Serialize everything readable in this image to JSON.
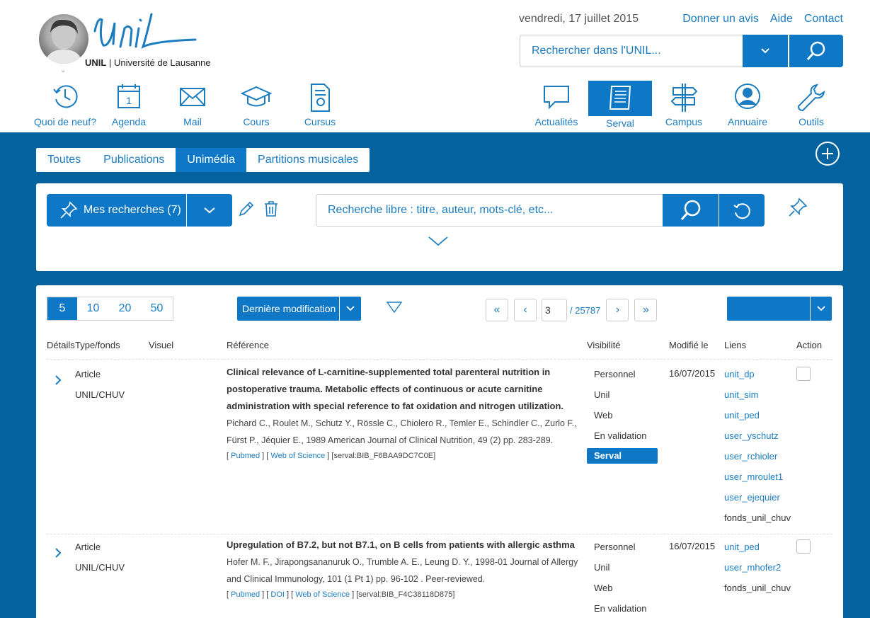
{
  "header": {
    "logo_wordmark": "Unil",
    "logo_short": "UNIL",
    "logo_long": "Université de Lausanne",
    "date": "vendredi, 17 juillet 2015",
    "top_links": [
      "Donner un avis",
      "Aide",
      "Contact"
    ],
    "search_placeholder": "Rechercher dans l'UNIL...",
    "left_nav": [
      {
        "label": "Quoi de neuf?",
        "icon": "clock-icon"
      },
      {
        "label": "Agenda",
        "icon": "calendar-icon",
        "day": "1"
      },
      {
        "label": "Mail",
        "icon": "envelope-icon"
      },
      {
        "label": "Cours",
        "icon": "graduation-cap-icon"
      },
      {
        "label": "Cursus",
        "icon": "certificate-icon"
      }
    ],
    "right_nav": [
      {
        "label": "Actualités",
        "icon": "speech-bubble-icon"
      },
      {
        "label": "Serval",
        "icon": "scroll-icon",
        "active": true
      },
      {
        "label": "Campus",
        "icon": "signpost-icon"
      },
      {
        "label": "Annuaire",
        "icon": "person-icon"
      },
      {
        "label": "Outils",
        "icon": "wrench-icon"
      }
    ]
  },
  "tabs": [
    "Toutes",
    "Publications",
    "Unimédia",
    "Partitions musicales"
  ],
  "active_tab": "Unimédia",
  "search_panel": {
    "saved_searches_label": "Mes recherches (7)",
    "free_search_placeholder": "Recherche libre : titre, auteur, mots-clé, etc..."
  },
  "results": {
    "page_sizes": [
      "5",
      "10",
      "20",
      "50"
    ],
    "active_page_size": "5",
    "sort_label": "Dernière modification",
    "current_page": "3",
    "total_pages": "/ 25787",
    "columns": [
      "Détails",
      "Type/fonds",
      "Visuel",
      "Référence",
      "Visibilité",
      "Modifié le",
      "Liens",
      "Action"
    ],
    "rows": [
      {
        "type": "Article",
        "fonds": "UNIL/CHUV",
        "title": "Clinical relevance of L-carnitine-supplemented total parenteral nutrition in postoperative trauma. Metabolic effects of continuous or acute carnitine administration with special reference to fat oxidation and nitrogen utilization.",
        "authors": "Pichard C., Roulet M., Schutz Y., Rössle C., Chiolero R., Temler E., Schindler C., Zurlo F., Fürst P., Jéquier E., 1989 American Journal of Clinical Nutrition, 49 (2) pp. 283-289.",
        "refs": [
          "Pubmed",
          "Web of Science"
        ],
        "serval_id": "[serval:BIB_F6BAA9DC7C0E]",
        "visibility": [
          "Personnel",
          "Unil",
          "Web",
          "En validation",
          "Serval"
        ],
        "visibility_selected": "Serval",
        "modified": "16/07/2015",
        "links": [
          "unit_dp",
          "unit_sim",
          "unit_ped",
          "user_yschutz",
          "user_rchioler",
          "user_mroulet1",
          "user_ejequier"
        ],
        "fonds_link": "fonds_unil_chuv"
      },
      {
        "type": "Article",
        "fonds": "UNIL/CHUV",
        "title": "Upregulation of B7.2, but not B7.1, on B cells from patients with allergic asthma",
        "authors": "Hofer M. F., Jirapongsananuruk O., Trumble A. E., Leung D. Y., 1998-01 Journal of Allergy and Clinical Immunology, 101 (1 Pt 1) pp. 96-102 . Peer-reviewed.",
        "refs": [
          "Pubmed",
          "DOI",
          "Web of Science"
        ],
        "serval_id": "[serval:BIB_F4C38118D875]",
        "visibility": [
          "Personnel",
          "Unil",
          "Web",
          "En validation"
        ],
        "modified": "16/07/2015",
        "links": [
          "unit_ped",
          "user_mhofer2"
        ],
        "fonds_link": "fonds_unil_chuv"
      }
    ]
  },
  "colors": {
    "accent": "#0e77c6",
    "band": "#04639e"
  }
}
